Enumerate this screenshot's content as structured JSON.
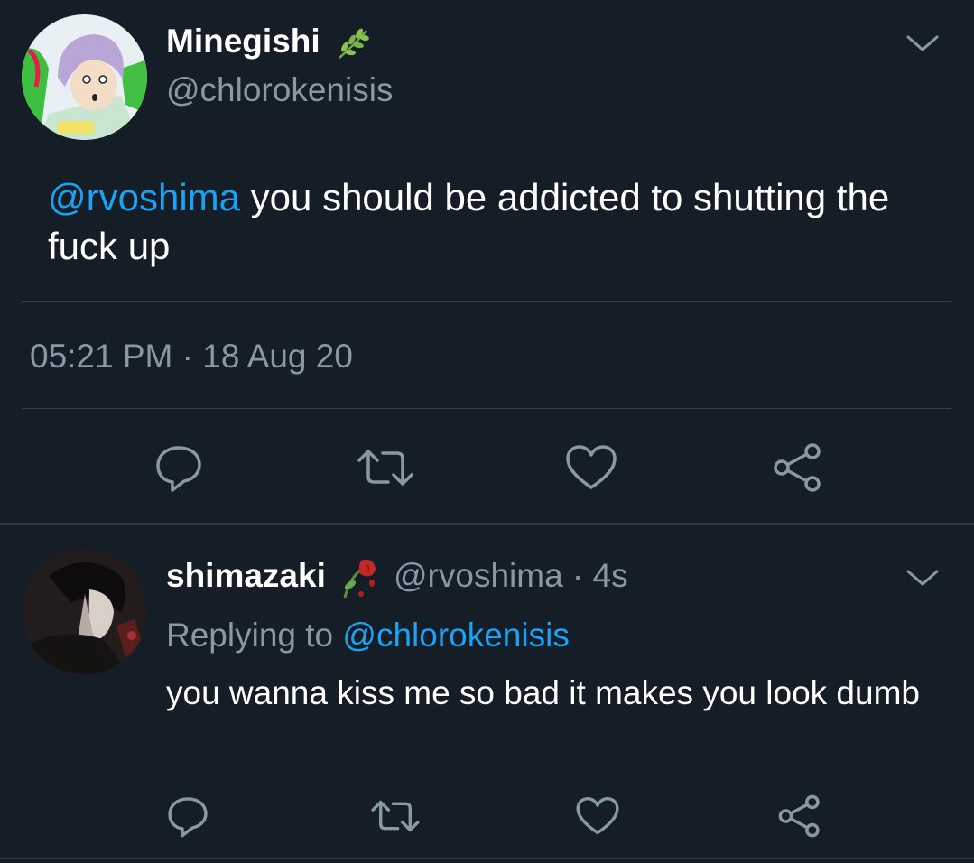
{
  "colors": {
    "background": "#151d27",
    "text_primary": "#ffffff",
    "text_secondary": "#8899a6",
    "link": "#1da1f2",
    "divider": "#38444d",
    "icon": "#8899a6"
  },
  "main_tweet": {
    "display_name": "Minegishi",
    "name_emoji": "herb-icon",
    "handle": "@chlorokenisis",
    "mention": "@rvoshima",
    "text": " you should be addicted to shutting the fuck up",
    "timestamp": "05:21 PM · 18 Aug 20",
    "actions": [
      "reply-icon",
      "retweet-icon",
      "like-icon",
      "share-icon"
    ]
  },
  "reply_tweet": {
    "display_name": "shimazaki",
    "name_emoji": "wilted-rose-icon",
    "handle_time": "@rvoshima · 4s",
    "replying_to_label": "Replying to ",
    "replying_to_handle": "@chlorokenisis",
    "text": "you wanna kiss me so bad it makes you look dumb",
    "actions": [
      "reply-icon",
      "retweet-icon",
      "like-icon",
      "share-icon"
    ]
  }
}
